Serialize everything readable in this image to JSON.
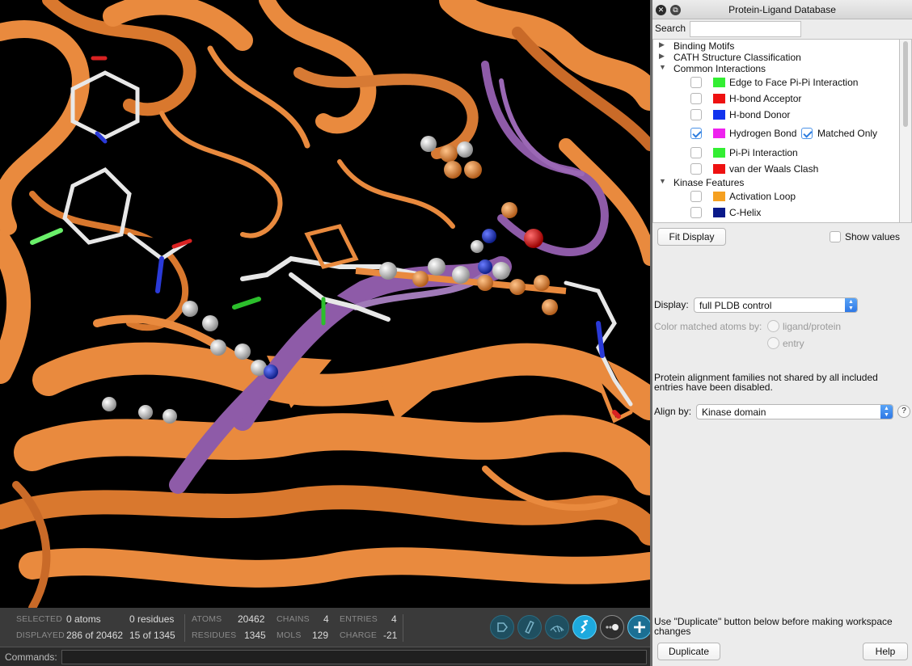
{
  "status": {
    "selected_label": "SELECTED",
    "selected_atoms": "0 atoms",
    "selected_residues": "0 residues",
    "displayed_label": "DISPLAYED",
    "displayed_atoms": "286 of 20462",
    "displayed_residues": "15 of 1345",
    "atoms_label": "ATOMS",
    "atoms_value": "20462",
    "residues_label": "RESIDUES",
    "residues_value": "1345",
    "chains_label": "CHAINS",
    "chains_value": "4",
    "mols_label": "MOLS",
    "mols_value": "129",
    "entries_label": "ENTRIES",
    "entries_value": "4",
    "charge_label": "CHARGE",
    "charge_value": "-21"
  },
  "toolbar_icons": [
    "style-tag-icon",
    "ribbon-style-icon",
    "surface-mesh-icon",
    "ribbon-toggle-icon",
    "display-toggle-icon",
    "add-icon"
  ],
  "command": {
    "label": "Commands:",
    "value": ""
  },
  "panel": {
    "title": "Protein-Ligand Database",
    "close_glyph": "✕",
    "restore_glyph": "⧉",
    "search_label": "Search",
    "search_value": "",
    "tree": [
      {
        "label": "Binding Motifs",
        "expanded": false
      },
      {
        "label": "CATH Structure Classification",
        "expanded": false
      },
      {
        "label": "Common Interactions",
        "expanded": true
      },
      {
        "label": "Kinase Features",
        "expanded": true
      }
    ],
    "interactions": [
      {
        "label": "Edge to Face Pi-Pi Interaction",
        "color": "#33ee33",
        "checked": false
      },
      {
        "label": "H-bond Acceptor",
        "color": "#ee1111",
        "checked": false
      },
      {
        "label": "H-bond Donor",
        "color": "#1133ee",
        "checked": false
      },
      {
        "label": "Hydrogen Bond",
        "color": "#ee22ee",
        "checked": true,
        "extra": "Matched Only",
        "extra_checked": true
      },
      {
        "label": "Pi-Pi Interaction",
        "color": "#33ee33",
        "checked": false
      },
      {
        "label": "van der Waals Clash",
        "color": "#ee1111",
        "checked": false
      }
    ],
    "kinase": [
      {
        "label": "Activation Loop",
        "color": "#f5a020",
        "checked": false
      },
      {
        "label": "C-Helix",
        "color": "#0a1a8a",
        "checked": false
      }
    ],
    "fit_display": "Fit Display",
    "show_values": "Show values",
    "display_label": "Display:",
    "display_value": "full PLDB control",
    "color_matched_label": "Color matched atoms by:",
    "radio_ligand": "ligand/protein",
    "radio_entry": "entry",
    "alignment_note": "Protein alignment families not shared by all included entries have been disabled.",
    "align_label": "Align by:",
    "align_value": "Kinase domain",
    "help_glyph": "?",
    "duplicate_note": "Use \"Duplicate\" button below before making workspace changes",
    "duplicate_button": "Duplicate",
    "help_button": "Help"
  },
  "colors": {
    "ribbon": "#e98a3e",
    "ribbon_dark": "#b96424",
    "ligand_purple": "#8e5ba8",
    "carbon": "#e0e0e0"
  }
}
